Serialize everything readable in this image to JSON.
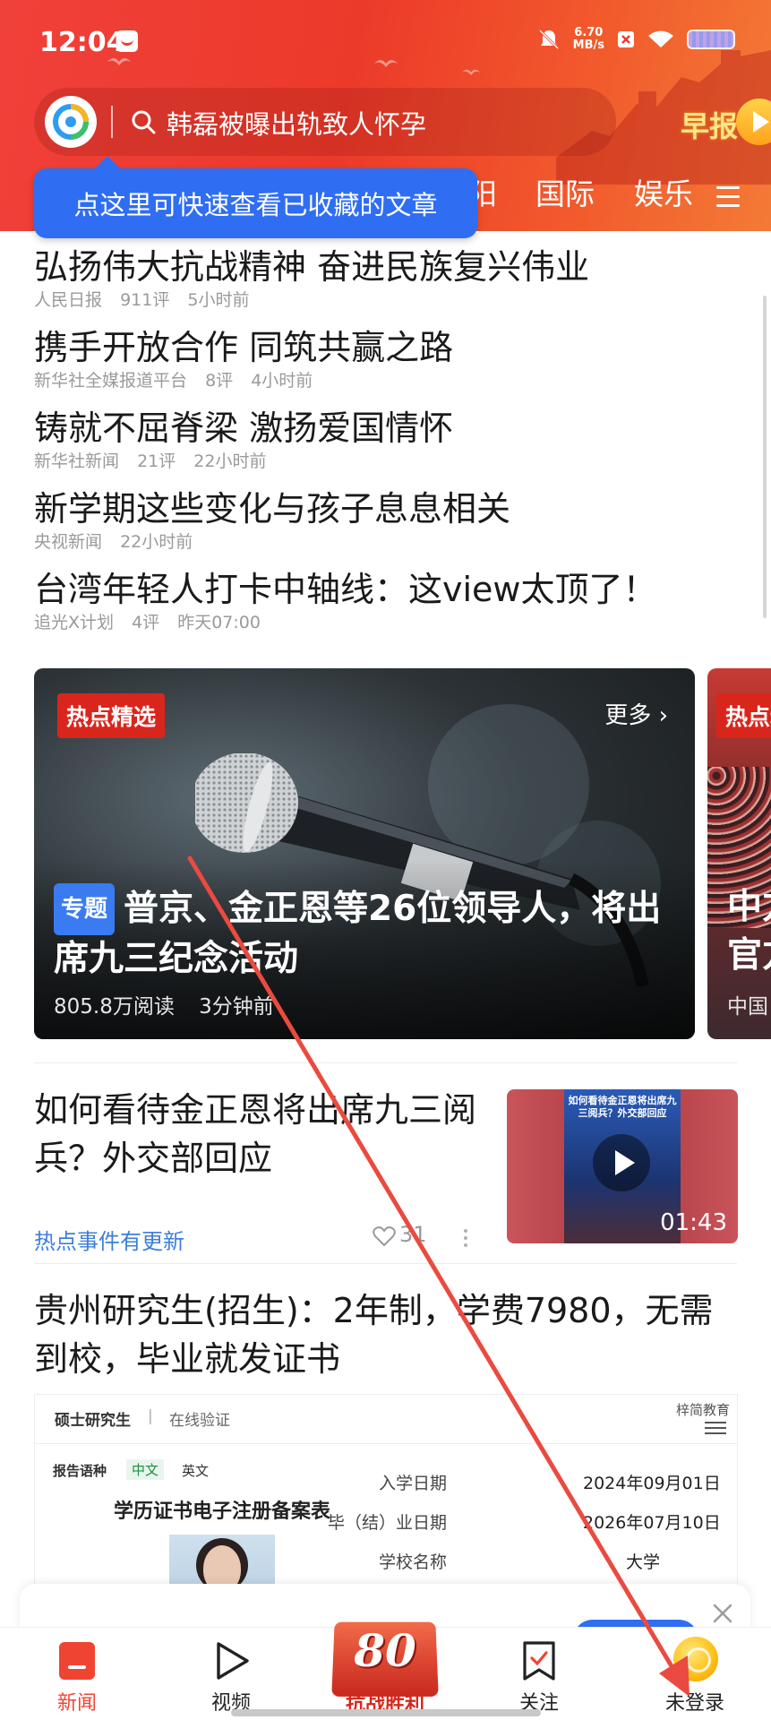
{
  "status_bar": {
    "time": "12:04",
    "net_speed_value": "6.70",
    "net_speed_unit": "MB/s"
  },
  "search": {
    "query": "韩磊被曝出轨致人怀孕",
    "morning_label": "早报"
  },
  "channels": {
    "visible": [
      "阳",
      "国际",
      "娱乐"
    ]
  },
  "tooltip": {
    "text": "点这里可快速查看已收藏的文章"
  },
  "headlines": [
    {
      "title": "弘扬伟大抗战精神  奋进民族复兴伟业",
      "source": "人民日报",
      "comments": "911评",
      "time": "5小时前"
    },
    {
      "title": "携手开放合作 同筑共赢之路",
      "source": "新华社全媒报道平台",
      "comments": "8评",
      "time": "4小时前"
    },
    {
      "title": "铸就不屈脊梁 激扬爱国情怀",
      "source": "新华社新闻",
      "comments": "21评",
      "time": "22小时前"
    },
    {
      "title": "新学期这些变化与孩子息息相关",
      "source": "央视新闻",
      "comments": "",
      "time": "22小时前"
    },
    {
      "title": "台湾年轻人打卡中轴线：这view太顶了！",
      "source": "追光X计划",
      "comments": "4评",
      "time": "昨天07:00"
    }
  ],
  "hot_card": {
    "badge": "热点精选",
    "more": "更多",
    "topic_badge": "专题",
    "title": "普京、金正恩等26位领导人，将出席九三纪念活动",
    "reads": "805.8万阅读",
    "time": "3分钟前"
  },
  "hot_card_2": {
    "badge": "热点精选",
    "title_line1": "中方",
    "title_line2": "官方",
    "meta": "中国"
  },
  "article1": {
    "title": "如何看待金正恩将出席九三阅兵？外交部回应",
    "tag": "热点事件有更新",
    "likes": "31",
    "video_caption": "如何看待金正恩将出席九三阅兵？外交部回应",
    "duration": "01:43"
  },
  "article2": {
    "title": "贵州研究生(招生)：2年制，学费7980，无需到校，毕业就发证书",
    "doc": {
      "header_left": "硕士研究生",
      "separator": "|",
      "header_right": "在线验证",
      "brand": "梓简教育",
      "lang_label": "报告语种",
      "lang_cn": "中文",
      "lang_en": "英文",
      "form_title": "学历证书电子注册备案表",
      "rows": [
        {
          "label": "入学日期",
          "value": "2024年09月01日"
        },
        {
          "label": "毕（结）业日期",
          "value": "2026年07月10日"
        },
        {
          "label": "学校名称",
          "value": "大学"
        }
      ]
    }
  },
  "bottom_nav": {
    "news": "新闻",
    "video": "视频",
    "center_number": "80",
    "center_text": "抗战胜利",
    "follow": "关注",
    "profile": "未登录"
  },
  "colors": {
    "header_red": "#ec3a2a",
    "tooltip_blue": "#2f6ef2",
    "hot_badge_red": "#d9261c",
    "tag_blue": "#3d7fd9",
    "annotation_arrow": "#ea4a3f"
  }
}
